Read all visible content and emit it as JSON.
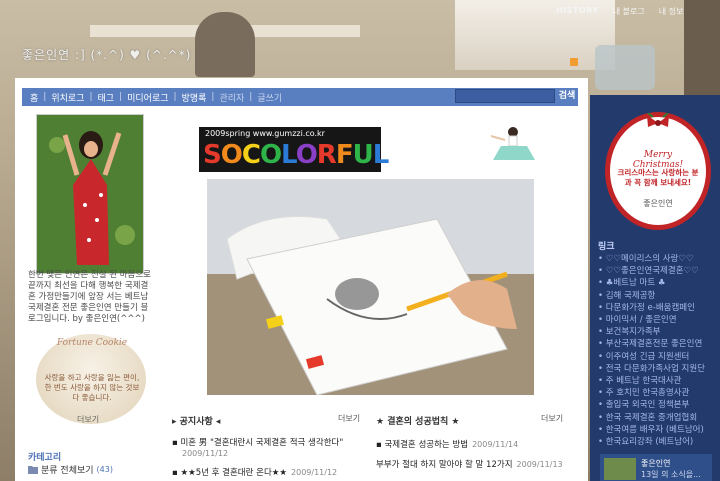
{
  "header": {
    "blog_title": "좋은인연 :]  (*.^) ♥ (^.^*)",
    "top_links": [
      "HISTORY",
      "내 블로그",
      "내 정보"
    ]
  },
  "nav": {
    "items": [
      "홈",
      "위치로그",
      "태그",
      "미디어로그",
      "방명록",
      "관리자",
      "글쓰기"
    ],
    "search_label": "검색"
  },
  "profile": {
    "intro": "한번 맺은 인연은 진실 된 마음으로 끝까지 최선을 다해 행복한 국제결혼 가정만들기에 앞장 서는 베트남 국제결혼 전문 좋은인연 만들기 블로그입니다. by 좋은인연(^^^)"
  },
  "fortune_cookie": {
    "title": "Fortune Cookie",
    "text": "사랑을 하고 사랑을 잃는 편이, 한 번도 사랑을 하지 않는 것보다 좋습니다.",
    "more": "더보기"
  },
  "category": {
    "title": "카테고리",
    "all_label": "분류 전체보기",
    "all_count": "(43)"
  },
  "banner": {
    "top_text": "2009spring  www.gumzzi.co.kr",
    "big_text": "SOCOLORFUL",
    "colors": [
      "#e53a2b",
      "#f08a1d",
      "#f5d019",
      "#2fb44a",
      "#2b7bd6",
      "#8a3fc7",
      "#e53a2b",
      "#f08a1d",
      "#2fb44a",
      "#2b7bd6"
    ]
  },
  "notice": {
    "title": "공지사항",
    "more": "더보기",
    "posts": [
      {
        "title": "미혼 男 \"결혼대란시 국제결혼 적극 생각한다\"",
        "date": "2009/11/12"
      },
      {
        "title": "★★5년 후 결혼대란 온다★★",
        "date": "2009/11/12"
      }
    ]
  },
  "success": {
    "title": "결혼의 성공법칙",
    "more": "더보기",
    "posts": [
      {
        "title": "국제결혼 성공하는 방법",
        "date": "2009/11/14"
      },
      {
        "title": "부부가 절대 하지 말아야 할 말 12가지",
        "date": "2009/11/13"
      }
    ]
  },
  "xmas_card": {
    "title": "Merry Christmas!",
    "text": "크리스마스는 사랑하는 분과 꼭 함께 보내세요!",
    "sign": "좋은인연"
  },
  "links": {
    "title": "링크",
    "items": [
      "♡♡메이리스의 사랑♡♡",
      "♡♡좋은인연국제결혼♡♡",
      "♣베트남 마트 ♣",
      "김해 국제공항",
      "다문화가정 e-배움캠페인",
      "마이믹서 / 좋은인연",
      "보건복지가족부",
      "부산국제결혼전문 좋은인연",
      "이주여성 긴급 지원센터",
      "전국 다문화가족사업 지원단",
      "주 베트남 한국대사관",
      "주 호치민 한국총영사관",
      "출입국 외국인 정책본부",
      "한국 국제결혼 중개업협회",
      "한국여름 배우자 (베트남어)",
      "한국요리강좌 (베트남어)"
    ]
  },
  "recent_card": {
    "name": "좋은인연",
    "text": "13일 의 소식을..."
  },
  "colors": {
    "nav_bg": "#5a7fc0",
    "sidebar_bg": "#233a6c",
    "accent_red": "#c02427"
  }
}
